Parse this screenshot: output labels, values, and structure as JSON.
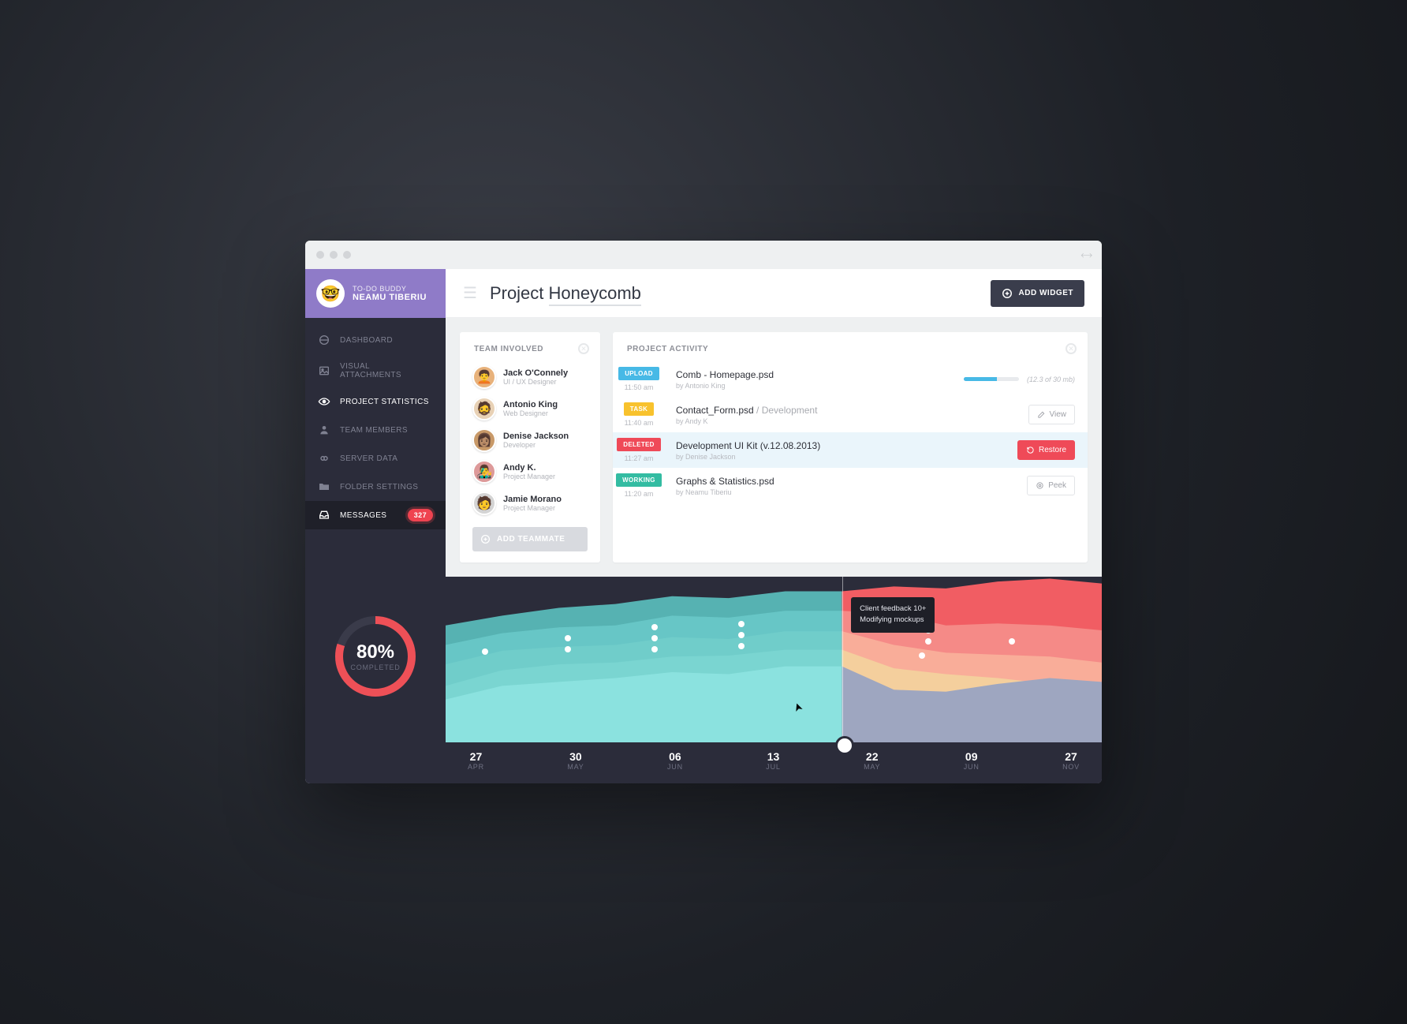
{
  "profile": {
    "app": "TO-DO BUDDY",
    "name": "NEAMU TIBERIU",
    "avatar": "🤓"
  },
  "nav": [
    {
      "label": "DASHBOARD",
      "icon": "dashboard"
    },
    {
      "label": "VISUAL ATTACHMENTS",
      "icon": "image"
    },
    {
      "label": "PROJECT STATISTICS",
      "icon": "eye",
      "active": true
    },
    {
      "label": "TEAM MEMBERS",
      "icon": "user"
    },
    {
      "label": "SERVER DATA",
      "icon": "infinity"
    },
    {
      "label": "FOLDER SETTINGS",
      "icon": "folder"
    },
    {
      "label": "MESSAGES",
      "icon": "inbox",
      "messages": true,
      "badge": "327"
    }
  ],
  "completion": {
    "percent": "80%",
    "label": "COMPLETED",
    "value": 80
  },
  "page": {
    "title_a": "Project ",
    "title_b": "Honeycomb",
    "add_widget": "ADD WIDGET"
  },
  "team": {
    "heading": "TEAM INVOLVED",
    "members": [
      {
        "name": "Jack O'Connely",
        "role": "UI / UX Designer",
        "emoji": "🧑‍🦱",
        "bg": "#e8b27b"
      },
      {
        "name": "Antonio King",
        "role": "Web Designer",
        "emoji": "🧔",
        "bg": "#e8d1b5"
      },
      {
        "name": "Denise Jackson",
        "role": "Developer",
        "emoji": "👩🏽",
        "bg": "#c89968"
      },
      {
        "name": "Andy K.",
        "role": "Project Manager",
        "emoji": "👨‍🎤",
        "bg": "#d99"
      },
      {
        "name": "Jamie Morano",
        "role": "Project Manager",
        "emoji": "🧑",
        "bg": "#d4d4d4"
      }
    ],
    "add_button": "ADD TEAMMATE"
  },
  "activity": {
    "heading": "PROJECT ACTIVITY",
    "rows": [
      {
        "tag": "UPLOAD",
        "tagClass": "upload",
        "time": "11:50 am",
        "title": "Comb - Homepage.psd",
        "by": "by Antonio King",
        "progress": 60,
        "size": "(12.3 of 30 mb)"
      },
      {
        "tag": "TASK",
        "tagClass": "task",
        "time": "11:40 am",
        "title": "Contact_Form.psd",
        "suffix": " / Development",
        "by": "by Andy K",
        "action": "View",
        "actionIcon": "edit"
      },
      {
        "tag": "DELETED",
        "tagClass": "del",
        "time": "11:27 am",
        "title": "Development UI Kit (v.12.08.2013)",
        "by": "by Denise Jackson",
        "action": "Restore",
        "actionIcon": "restore",
        "restore": true,
        "rowClass": "deleted"
      },
      {
        "tag": "WORKING",
        "tagClass": "working",
        "time": "11:20 am",
        "title": "Graphs & Statistics.psd",
        "by": "by Neamu Tiberiu",
        "action": "Peek",
        "actionIcon": "peek"
      }
    ]
  },
  "chart_data": {
    "type": "area",
    "tooltip": {
      "line1": "Client feedback 10+",
      "line2": "Modifying mockups"
    },
    "timeline": [
      {
        "day": "27",
        "month": "APR"
      },
      {
        "day": "30",
        "month": "MAY"
      },
      {
        "day": "06",
        "month": "JUN"
      },
      {
        "day": "13",
        "month": "JUL"
      },
      {
        "day": "22",
        "month": "MAY"
      },
      {
        "day": "09",
        "month": "JUN"
      },
      {
        "day": "27",
        "month": "NOV"
      }
    ],
    "marker_index": 4,
    "left_series": [
      {
        "color": "#56b2b2",
        "values": [
          120,
          130,
          138,
          142,
          150,
          148,
          155,
          155
        ]
      },
      {
        "color": "#67c6c6",
        "values": [
          100,
          112,
          118,
          120,
          130,
          128,
          135,
          135
        ]
      },
      {
        "color": "#70cdca",
        "values": [
          80,
          94,
          98,
          100,
          108,
          106,
          114,
          114
        ]
      },
      {
        "color": "#7ad5d1",
        "values": [
          58,
          74,
          80,
          82,
          88,
          89,
          95,
          95
        ]
      },
      {
        "color": "#8be2df",
        "values": [
          44,
          58,
          62,
          66,
          72,
          70,
          78,
          78
        ]
      }
    ],
    "right_series": [
      {
        "color": "#f15d63",
        "values": [
          155,
          160,
          158,
          165,
          168,
          163
        ]
      },
      {
        "color": "#f58a87",
        "values": [
          135,
          132,
          120,
          122,
          120,
          115
        ]
      },
      {
        "color": "#f9ad99",
        "values": [
          114,
          100,
          92,
          90,
          88,
          82
        ]
      },
      {
        "color": "#f4cf9d",
        "values": [
          95,
          76,
          70,
          66,
          60,
          55
        ]
      },
      {
        "color": "#9ea6c0",
        "values": [
          78,
          54,
          52,
          60,
          66,
          62
        ]
      }
    ],
    "ylim": [
      0,
      170
    ],
    "event_dots": [
      {
        "x": 50,
        "y": 95
      },
      {
        "x": 155,
        "y": 92
      },
      {
        "x": 155,
        "y": 78
      },
      {
        "x": 265,
        "y": 92
      },
      {
        "x": 265,
        "y": 78
      },
      {
        "x": 265,
        "y": 64
      },
      {
        "x": 375,
        "y": 88
      },
      {
        "x": 375,
        "y": 74
      },
      {
        "x": 375,
        "y": 60
      },
      {
        "x": 612,
        "y": 82
      },
      {
        "x": 612,
        "y": 68
      },
      {
        "x": 718,
        "y": 82
      },
      {
        "x": 604,
        "y": 100
      }
    ]
  }
}
